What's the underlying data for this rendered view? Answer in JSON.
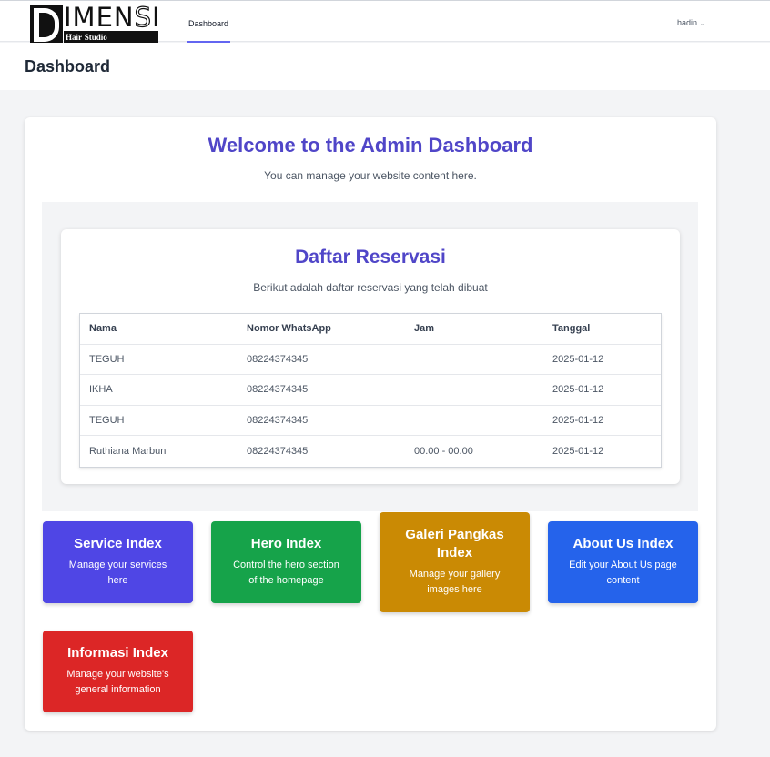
{
  "logo": {
    "word_first": "IMEN",
    "word_outline": "S",
    "word_last": "I",
    "sub_a": "Hair",
    "sub_b": "Studio"
  },
  "nav": {
    "dashboard_label": "Dashboard",
    "user_name": "hadin",
    "user_chevron": "⌄"
  },
  "header": {
    "title": "Dashboard"
  },
  "welcome": {
    "title": "Welcome to the Admin Dashboard",
    "subtitle": "You can manage your website content here."
  },
  "reservasi": {
    "title": "Daftar Reservasi",
    "subtitle": "Berikut adalah daftar reservasi yang telah dibuat",
    "columns": [
      "Nama",
      "Nomor WhatsApp",
      "Jam",
      "Tanggal"
    ],
    "rows": [
      [
        "TEGUH",
        "08224374345",
        "",
        "2025-01-12"
      ],
      [
        "IKHA",
        "08224374345",
        "",
        "2025-01-12"
      ],
      [
        "TEGUH",
        "08224374345",
        "",
        "2025-01-12"
      ],
      [
        "Ruthiana Marbun",
        "08224374345",
        "00.00 - 00.00",
        "2025-01-12"
      ]
    ]
  },
  "tiles": [
    {
      "title": "Service Index",
      "desc": "Manage your services here",
      "color": "#4f46e5"
    },
    {
      "title": "Hero Index",
      "desc": "Control the hero section of the homepage",
      "color": "#16a34a"
    },
    {
      "title": "Galeri Pangkas Index",
      "desc": "Manage your gallery images here",
      "color": "#ca8a04"
    },
    {
      "title": "About Us Index",
      "desc": "Edit your About Us page content",
      "color": "#2563eb"
    },
    {
      "title": "Informasi Index",
      "desc": "Manage your website's general information",
      "color": "#dc2626"
    }
  ]
}
